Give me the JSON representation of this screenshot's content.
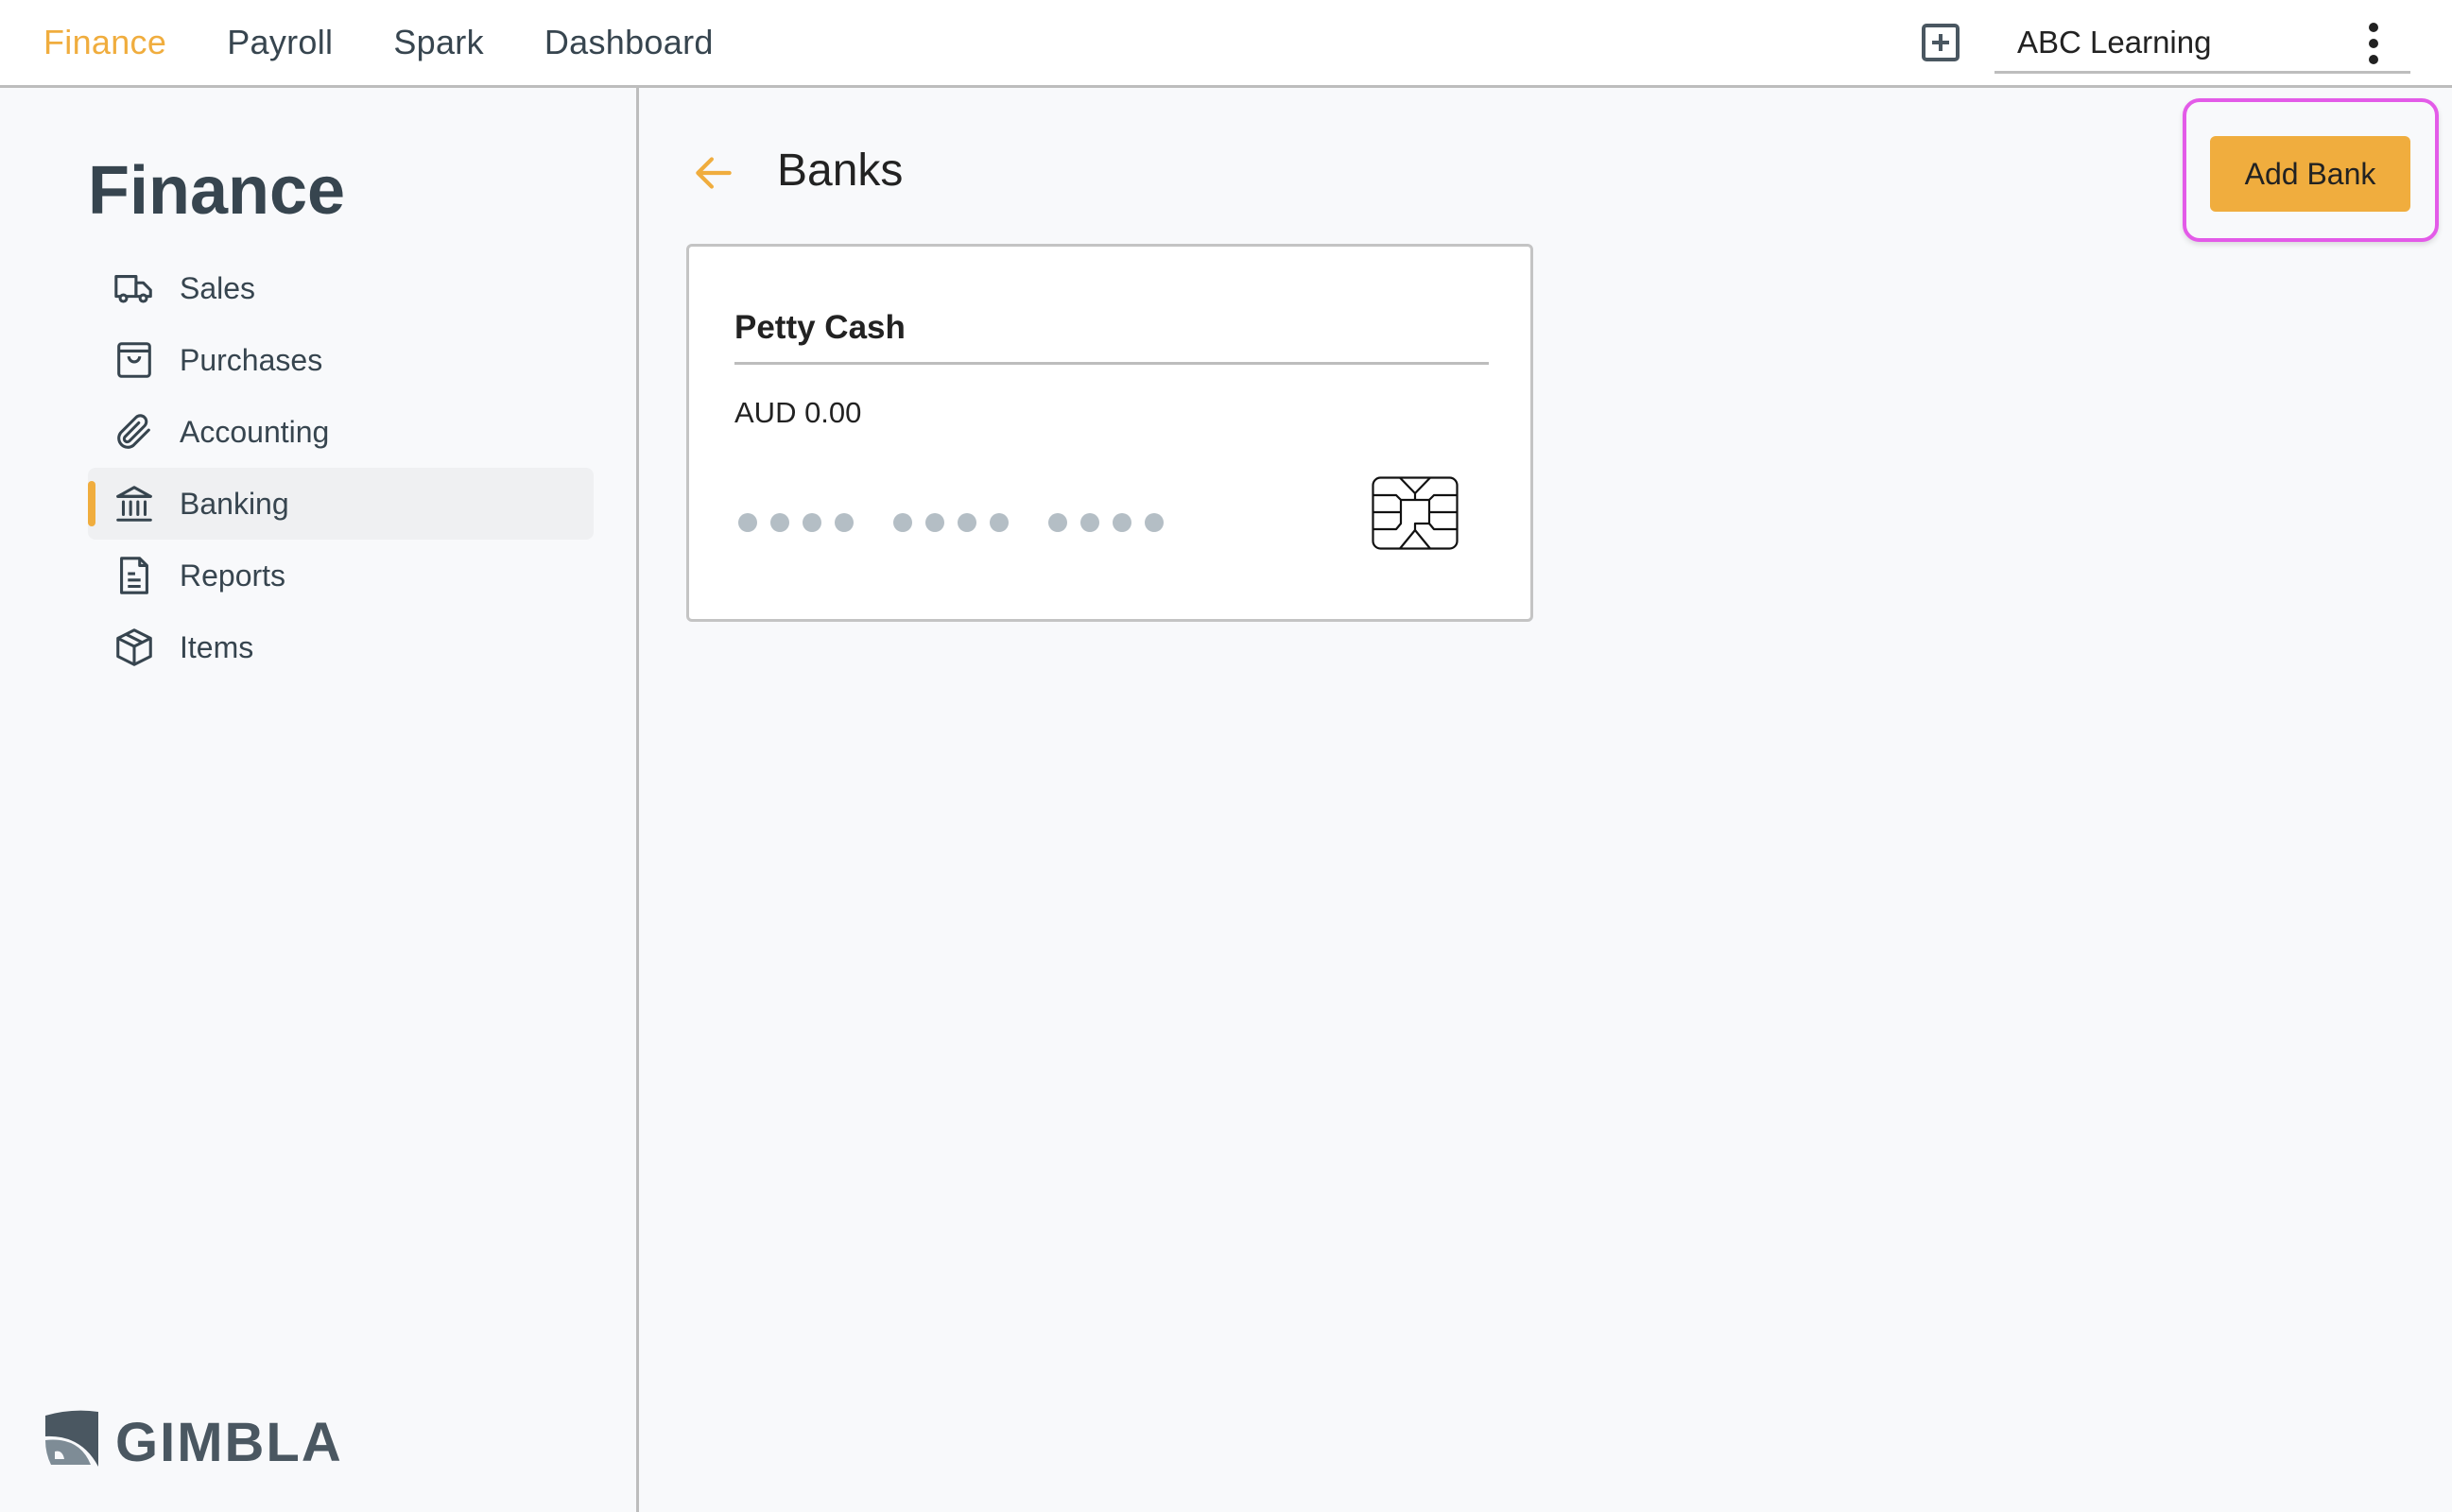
{
  "topnav": {
    "tabs": [
      {
        "label": "Finance",
        "active": true
      },
      {
        "label": "Payroll",
        "active": false
      },
      {
        "label": "Spark",
        "active": false
      },
      {
        "label": "Dashboard",
        "active": false
      }
    ],
    "add_icon": "plus-square-icon",
    "organization": "ABC Learning",
    "more_icon": "kebab-menu-icon"
  },
  "sidebar": {
    "title": "Finance",
    "items": [
      {
        "label": "Sales",
        "icon": "truck-icon",
        "active": false
      },
      {
        "label": "Purchases",
        "icon": "shopping-bag-icon",
        "active": false
      },
      {
        "label": "Accounting",
        "icon": "paperclip-icon",
        "active": false
      },
      {
        "label": "Banking",
        "icon": "bank-icon",
        "active": true
      },
      {
        "label": "Reports",
        "icon": "document-icon",
        "active": false
      },
      {
        "label": "Items",
        "icon": "box-icon",
        "active": false
      }
    ],
    "logo_text": "GIMBLA"
  },
  "main": {
    "back_icon": "arrow-left-icon",
    "title": "Banks",
    "add_button_label": "Add Bank",
    "banks": [
      {
        "name": "Petty Cash",
        "balance": "AUD 0.00",
        "masked_number_groups": 3,
        "chip_icon": "card-chip-icon"
      }
    ]
  },
  "colors": {
    "accent": "#f0ad3e",
    "text_primary": "#37454f",
    "highlight": "#e35be8",
    "background": "#f8f9fb"
  }
}
